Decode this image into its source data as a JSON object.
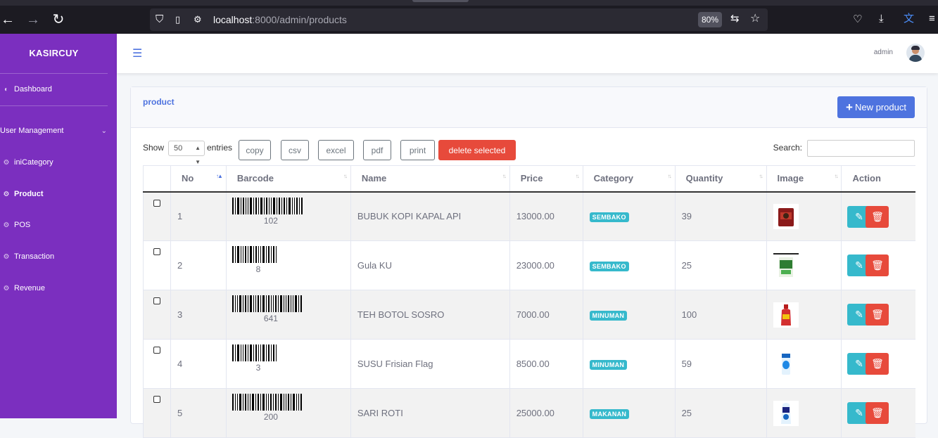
{
  "browser": {
    "url_host": "localhost",
    "url_rest": ":8000/admin/products",
    "zoom": "80%"
  },
  "sidebar": {
    "brand": "KASIRCUY",
    "items": [
      {
        "label": "Dashboard",
        "icon": "dashboard-icon"
      },
      {
        "label": "User Management",
        "icon": "users-icon"
      },
      {
        "label": "iniCategory",
        "icon": "cogs-icon"
      },
      {
        "label": "Product",
        "icon": "cogs-icon"
      },
      {
        "label": "POS",
        "icon": "cogs-icon"
      },
      {
        "label": "Transaction",
        "icon": "cogs-icon"
      },
      {
        "label": "Revenue",
        "icon": "cogs-icon"
      }
    ]
  },
  "topnav": {
    "user": "admin"
  },
  "card": {
    "title": "product",
    "new_button": "New product"
  },
  "controls": {
    "show": "Show",
    "entries_value": "50",
    "entries": "entries",
    "buttons": [
      "copy",
      "csv",
      "excel",
      "pdf",
      "print",
      "delete selected"
    ],
    "search_label": "Search:"
  },
  "table": {
    "headers": [
      "No",
      "Barcode",
      "Name",
      "Price",
      "Category",
      "Quantity",
      "Image",
      "Action"
    ],
    "rows": [
      {
        "no": "1",
        "barcode": "102",
        "name": "BUBUK KOPI KAPAL API",
        "price": "13000.00",
        "category": "SEMBAKO",
        "quantity": "39"
      },
      {
        "no": "2",
        "barcode": "8",
        "name": "Gula KU",
        "price": "23000.00",
        "category": "SEMBAKO",
        "quantity": "25"
      },
      {
        "no": "3",
        "barcode": "641",
        "name": "TEH BOTOL SOSRO",
        "price": "7000.00",
        "category": "MINUMAN",
        "quantity": "100"
      },
      {
        "no": "4",
        "barcode": "3",
        "name": "SUSU Frisian Flag",
        "price": "8500.00",
        "category": "MINUMAN",
        "quantity": "59"
      },
      {
        "no": "5",
        "barcode": "200",
        "name": "SARI ROTI",
        "price": "25000.00",
        "category": "MAKANAN",
        "quantity": "25"
      }
    ]
  }
}
